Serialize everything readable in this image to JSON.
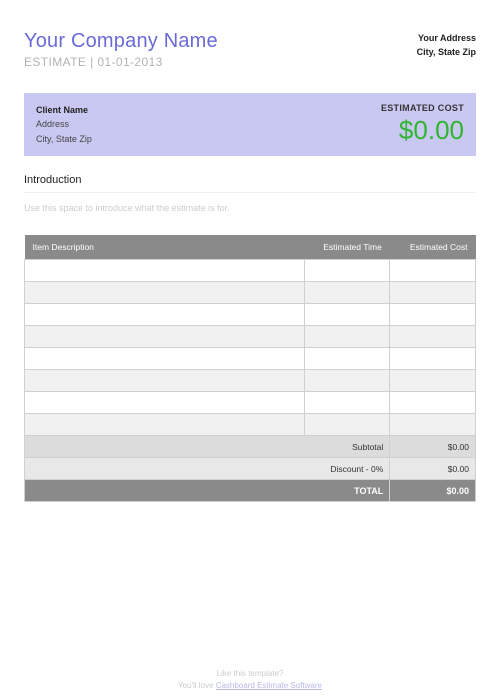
{
  "header": {
    "company_name": "Your Company Name",
    "estimate_label": "ESTIMATE",
    "estimate_date": "01-01-2013",
    "your_address_line1": "Your Address",
    "your_address_line2": "City, State Zip"
  },
  "client_box": {
    "client_name": "Client Name",
    "address": "Address",
    "city_state_zip": "City, State Zip",
    "estimated_cost_label": "ESTIMATED COST",
    "estimated_cost_value": "$0.00"
  },
  "intro": {
    "heading": "Introduction",
    "placeholder": "Use this space to introduce what the estimate is for."
  },
  "table": {
    "headers": {
      "description": "Item Description",
      "estimated_time": "Estimated Time",
      "estimated_cost": "Estimated Cost"
    },
    "subtotal_label": "Subtotal",
    "subtotal_value": "$0.00",
    "discount_label": "Discount - 0%",
    "discount_value": "$0.00",
    "total_label": "TOTAL",
    "total_value": "$0.00"
  },
  "footer": {
    "line1": "Like this template?",
    "line2_prefix": "You'll love ",
    "link_text": "Cashboard Estimate Software"
  }
}
